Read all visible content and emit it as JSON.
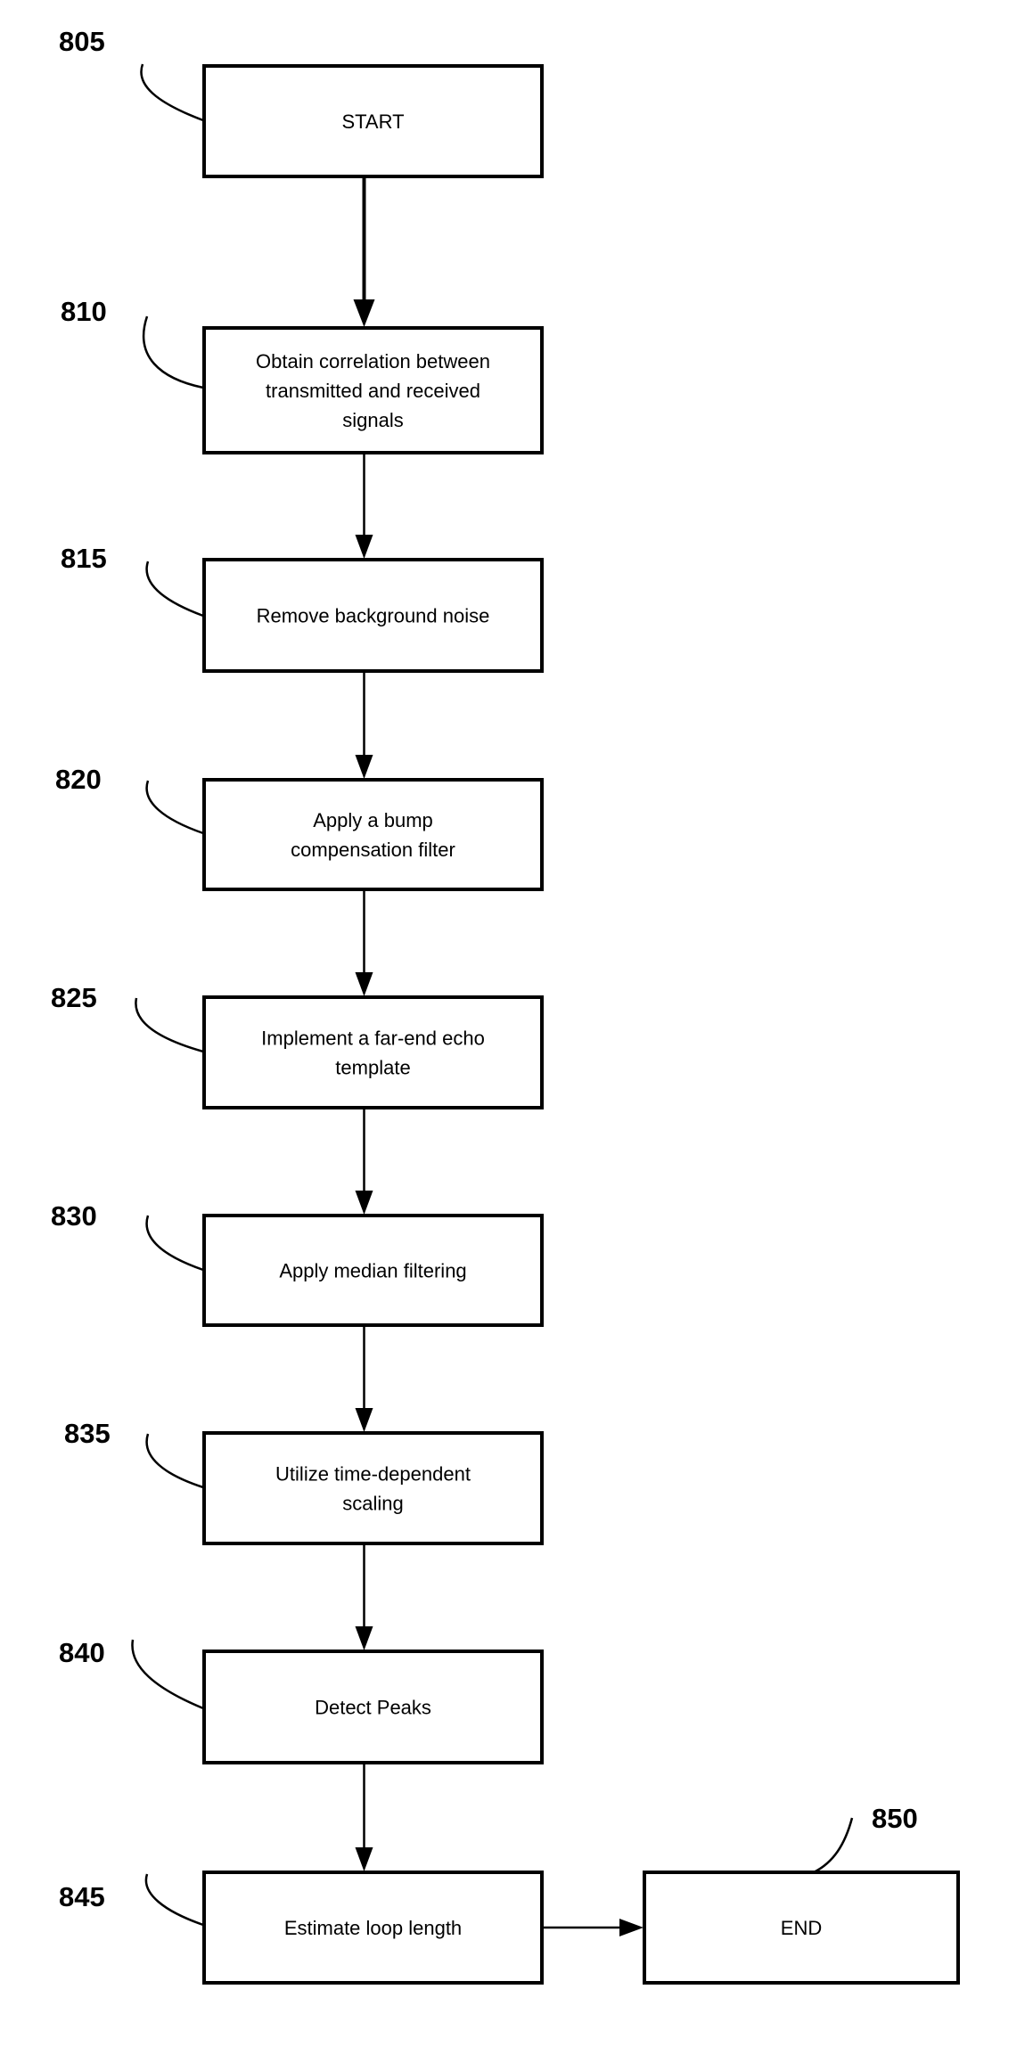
{
  "diagram": {
    "type": "flowchart",
    "direction": "top-to-bottom",
    "colors": {
      "stroke": "#000000",
      "background": "#ffffff",
      "text": "#000000"
    },
    "steps": [
      {
        "ref": "805",
        "lines": [
          "START"
        ]
      },
      {
        "ref": "810",
        "lines": [
          "Obtain correlation between",
          "transmitted and received",
          "signals"
        ]
      },
      {
        "ref": "815",
        "lines": [
          "Remove background noise"
        ]
      },
      {
        "ref": "820",
        "lines": [
          "Apply a bump",
          "compensation filter"
        ]
      },
      {
        "ref": "825",
        "lines": [
          "Implement a far-end echo",
          "template"
        ]
      },
      {
        "ref": "830",
        "lines": [
          "Apply median filtering"
        ]
      },
      {
        "ref": "835",
        "lines": [
          "Utilize time-dependent",
          "scaling"
        ]
      },
      {
        "ref": "840",
        "lines": [
          "Detect Peaks"
        ]
      },
      {
        "ref": "845",
        "lines": [
          "Estimate loop length"
        ]
      },
      {
        "ref": "850",
        "lines": [
          "END"
        ]
      }
    ],
    "edges": [
      {
        "from": "805",
        "to": "810"
      },
      {
        "from": "810",
        "to": "815"
      },
      {
        "from": "815",
        "to": "820"
      },
      {
        "from": "820",
        "to": "825"
      },
      {
        "from": "825",
        "to": "830"
      },
      {
        "from": "830",
        "to": "835"
      },
      {
        "from": "835",
        "to": "840"
      },
      {
        "from": "840",
        "to": "845"
      },
      {
        "from": "845",
        "to": "850"
      }
    ]
  }
}
